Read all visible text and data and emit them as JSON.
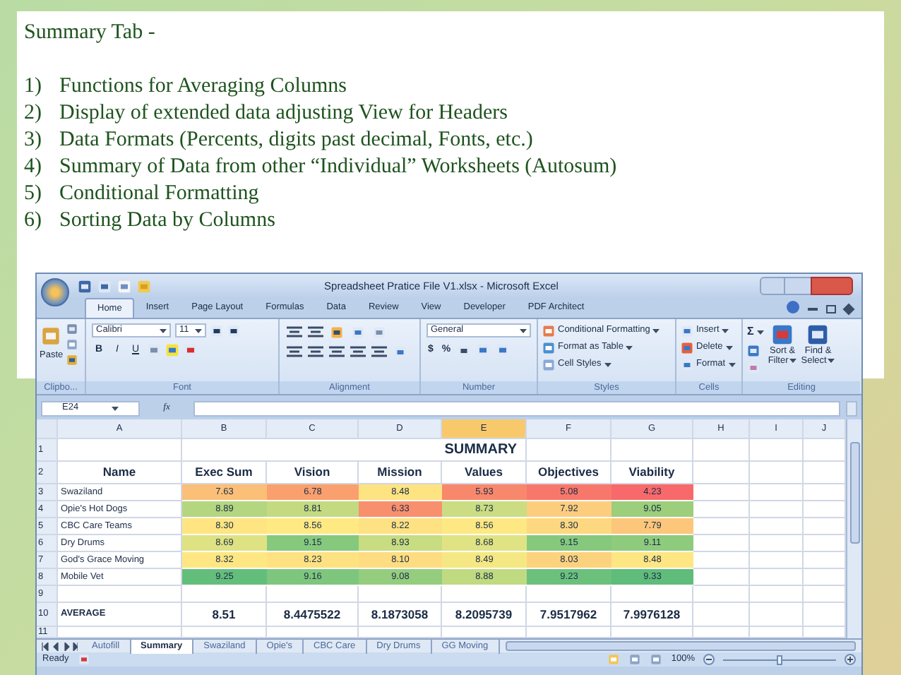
{
  "slide": {
    "title": "Summary Tab -",
    "items": [
      {
        "number": "1)",
        "text": "Functions for Averaging Columns"
      },
      {
        "number": "2)",
        "text": "Display of extended data adjusting View for Headers"
      },
      {
        "number": "3)",
        "text": "Data Formats (Percents, digits past decimal, Fonts, etc.)"
      },
      {
        "number": "4)",
        "text": "Summary of Data from other “Individual” Worksheets (Autosum)"
      },
      {
        "number": "5)",
        "text": "Conditional Formatting"
      },
      {
        "number": "6)",
        "text": "Sorting Data by Columns"
      }
    ]
  },
  "excel": {
    "title": "Spreadsheet Pratice File V1.xlsx - Microsoft Excel",
    "tabs": [
      {
        "label": "Home",
        "selected": true
      },
      {
        "label": "Insert",
        "selected": false
      },
      {
        "label": "Page Layout",
        "selected": false
      },
      {
        "label": "Formulas",
        "selected": false
      },
      {
        "label": "Data",
        "selected": false
      },
      {
        "label": "Review",
        "selected": false
      },
      {
        "label": "View",
        "selected": false
      },
      {
        "label": "Developer",
        "selected": false
      },
      {
        "label": "PDF Architect",
        "selected": false
      }
    ],
    "ribbon": {
      "clipboard": {
        "label": "Clipbo...",
        "paste": "Paste"
      },
      "font": {
        "label": "Font",
        "font_name": "Calibri",
        "font_size": "11",
        "buttons": [
          "B",
          "I",
          "U"
        ]
      },
      "alignment": {
        "label": "Alignment"
      },
      "number": {
        "label": "Number",
        "format": "General",
        "buttons": [
          "$",
          "%"
        ]
      },
      "styles": {
        "label": "Styles",
        "items": [
          "Conditional Formatting",
          "Format as Table",
          "Cell Styles"
        ]
      },
      "cells": {
        "label": "Cells",
        "items": [
          "Insert",
          "Delete",
          "Format"
        ]
      },
      "editing": {
        "label": "Editing",
        "sigma": "Σ",
        "items": [
          [
            "Sort &",
            "Filter"
          ],
          [
            "Find &",
            "Select"
          ]
        ]
      }
    },
    "formula_bar": {
      "name_box": "E24",
      "fx": "fx"
    },
    "columns": [
      {
        "label": "A",
        "selected": false
      },
      {
        "label": "B",
        "selected": false
      },
      {
        "label": "C",
        "selected": false
      },
      {
        "label": "D",
        "selected": false
      },
      {
        "label": "E",
        "selected": true
      },
      {
        "label": "F",
        "selected": false
      },
      {
        "label": "G",
        "selected": false
      },
      {
        "label": "H",
        "selected": false
      },
      {
        "label": "I",
        "selected": false
      },
      {
        "label": "J",
        "selected": false
      }
    ],
    "row_numbers": [
      "1",
      "2",
      "3",
      "4",
      "5",
      "6",
      "7",
      "8",
      "9",
      "10",
      "11"
    ],
    "sheet_title": "SUMMARY",
    "headers": [
      "Name",
      "Exec Sum",
      "Vision",
      "Mission",
      "Values",
      "Objectives",
      "Viability"
    ],
    "rows": [
      {
        "cells": [
          {
            "value": "Swaziland"
          },
          {
            "value": "7.63",
            "color": "#fbbf78"
          },
          {
            "value": "6.78",
            "color": "#f9a06e"
          },
          {
            "value": "8.48",
            "color": "#fee383"
          },
          {
            "value": "5.93",
            "color": "#f8886c"
          },
          {
            "value": "5.08",
            "color": "#f8776b"
          },
          {
            "value": "4.23",
            "color": "#f8696b"
          }
        ]
      },
      {
        "cells": [
          {
            "value": "Opie's Hot Dogs"
          },
          {
            "value": "8.89",
            "color": "#b5d680"
          },
          {
            "value": "8.81",
            "color": "#c3da81"
          },
          {
            "value": "6.33",
            "color": "#f8906e"
          },
          {
            "value": "8.73",
            "color": "#cbdd82"
          },
          {
            "value": "7.92",
            "color": "#fdcd7e"
          },
          {
            "value": "9.05",
            "color": "#9cce7c"
          }
        ]
      },
      {
        "cells": [
          {
            "value": "CBC Care Teams"
          },
          {
            "value": "8.30",
            "color": "#fee582"
          },
          {
            "value": "8.56",
            "color": "#fee983"
          },
          {
            "value": "8.22",
            "color": "#fee182"
          },
          {
            "value": "8.56",
            "color": "#fde883"
          },
          {
            "value": "8.30",
            "color": "#fed880"
          },
          {
            "value": "7.79",
            "color": "#fcc67b"
          }
        ]
      },
      {
        "cells": [
          {
            "value": "Dry Drums"
          },
          {
            "value": "8.69",
            "color": "#dfe283"
          },
          {
            "value": "9.15",
            "color": "#86c97d"
          },
          {
            "value": "8.93",
            "color": "#c8dc81"
          },
          {
            "value": "8.68",
            "color": "#e0e383"
          },
          {
            "value": "9.15",
            "color": "#86c97d"
          },
          {
            "value": "9.11",
            "color": "#8ecb7d"
          }
        ]
      },
      {
        "cells": [
          {
            "value": "God's Grace Moving"
          },
          {
            "value": "8.32",
            "color": "#fee783"
          },
          {
            "value": "8.23",
            "color": "#fee282"
          },
          {
            "value": "8.10",
            "color": "#fedc81"
          },
          {
            "value": "8.49",
            "color": "#f5e884"
          },
          {
            "value": "8.03",
            "color": "#fdd27f"
          },
          {
            "value": "8.48",
            "color": "#fee683"
          }
        ]
      },
      {
        "cells": [
          {
            "value": "Mobile Vet"
          },
          {
            "value": "9.25",
            "color": "#63be7b"
          },
          {
            "value": "9.16",
            "color": "#7ec67d"
          },
          {
            "value": "9.08",
            "color": "#94cd7e"
          },
          {
            "value": "8.88",
            "color": "#c0da81"
          },
          {
            "value": "9.23",
            "color": "#6bc17c"
          },
          {
            "value": "9.33",
            "color": "#5fbc7b"
          }
        ]
      }
    ],
    "average": {
      "values": [
        "AVERAGE",
        "8.51",
        "8.4475522",
        "8.1873058",
        "8.2095739",
        "7.9517962",
        "7.9976128"
      ]
    },
    "sheet_tabs": [
      {
        "label": "Autofill",
        "selected": false
      },
      {
        "label": "Summary",
        "selected": true
      },
      {
        "label": "Swaziland",
        "selected": false
      },
      {
        "label": "Opie's",
        "selected": false
      },
      {
        "label": "CBC Care",
        "selected": false
      },
      {
        "label": "Dry Drums",
        "selected": false
      },
      {
        "label": "GG Moving",
        "selected": false
      }
    ],
    "status": {
      "text": "Ready",
      "zoom": "100%",
      "zoom_slider": {
        "level": 0.5
      }
    }
  }
}
